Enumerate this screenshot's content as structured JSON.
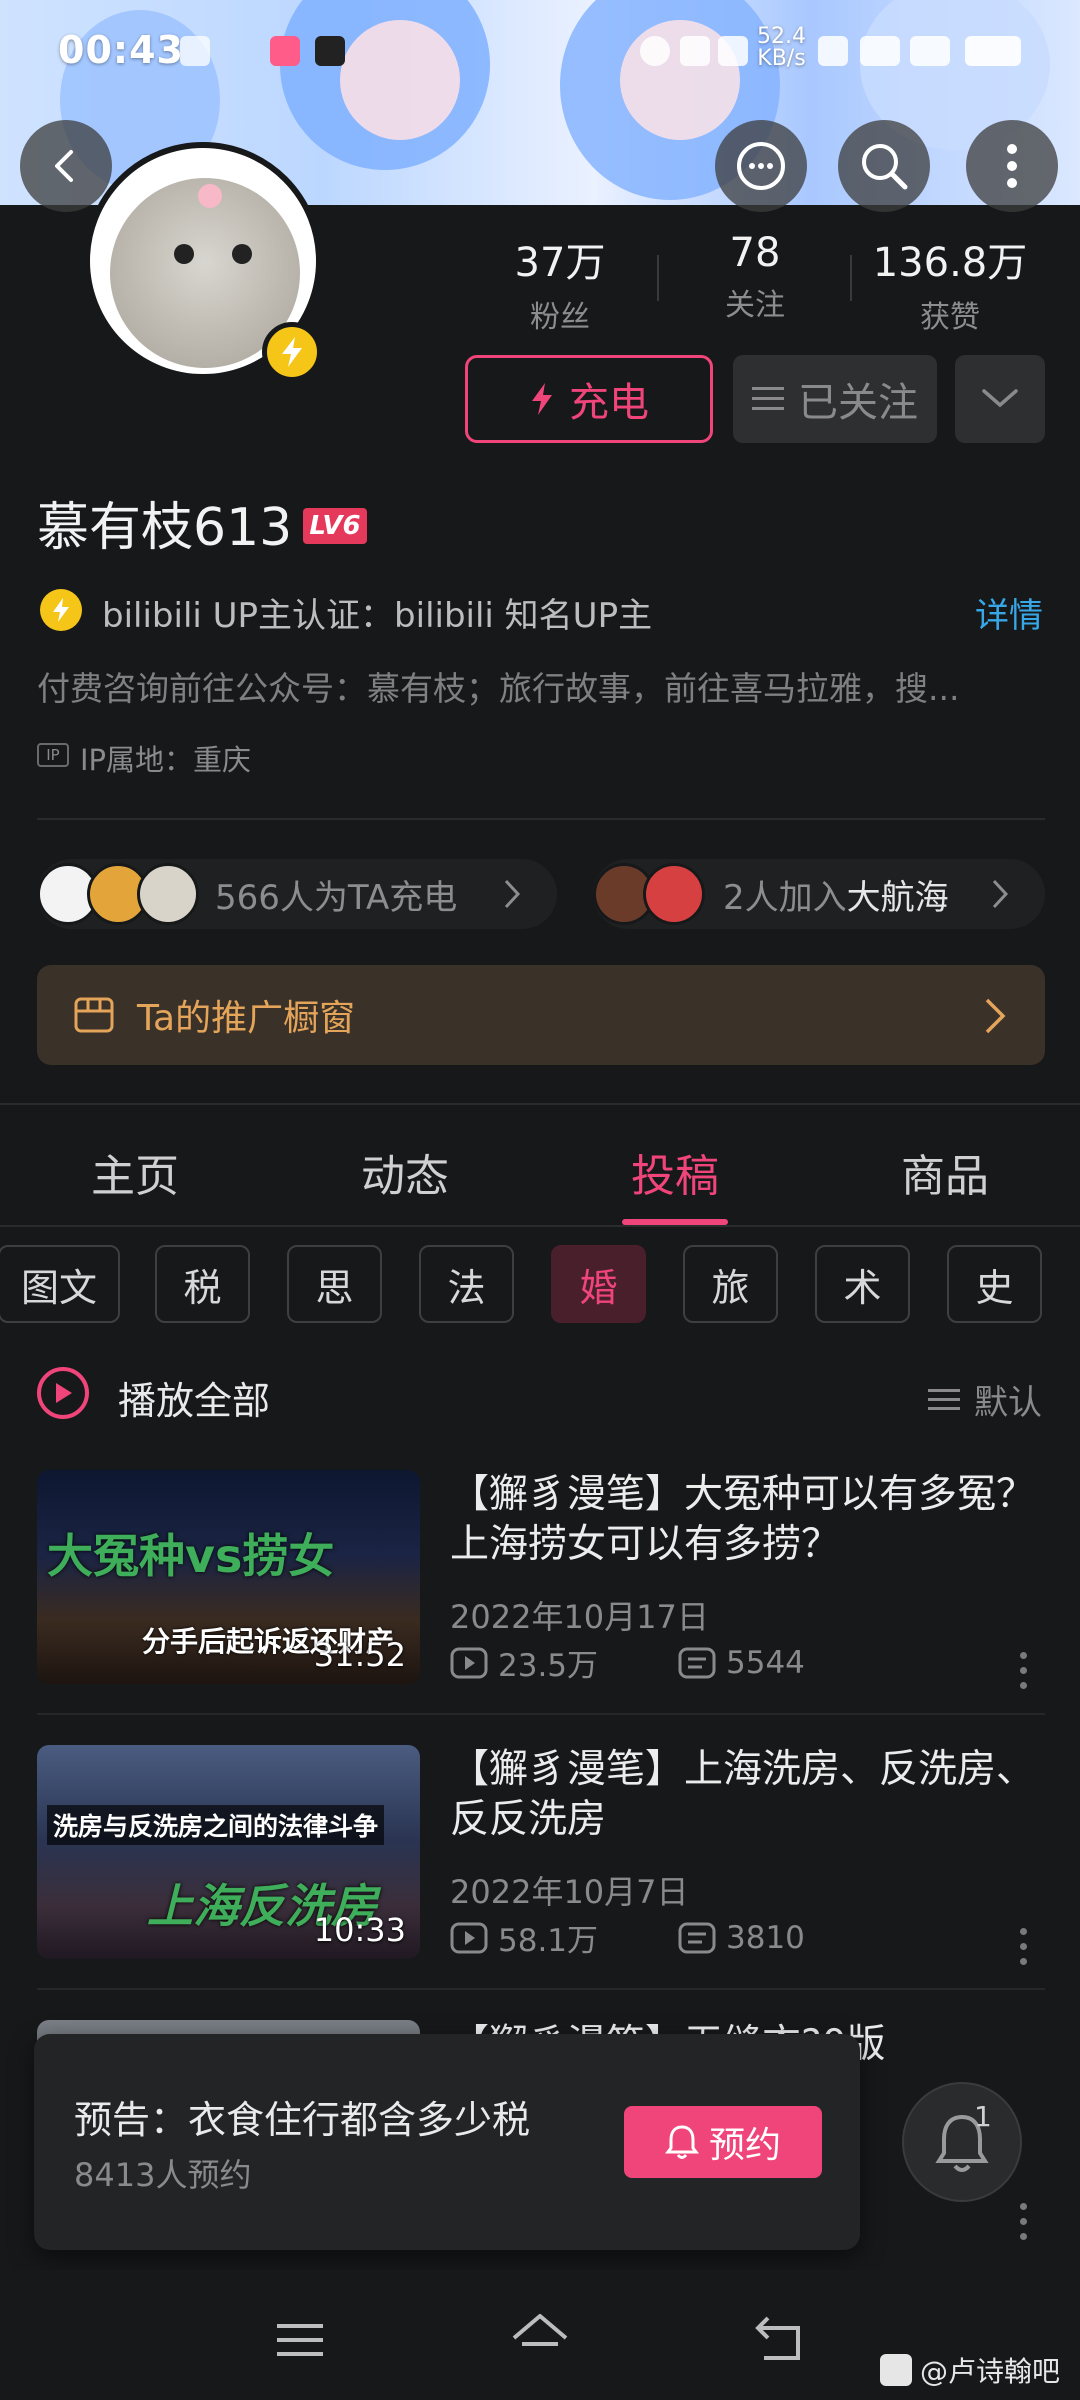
{
  "status_bar": {
    "time": "00:43",
    "net_speed": "52.4",
    "net_unit": "KB/s"
  },
  "profile": {
    "stats": [
      {
        "value": "37万",
        "label": "粉丝"
      },
      {
        "value": "78",
        "label": "关注"
      },
      {
        "value": "136.8万",
        "label": "获赞"
      }
    ],
    "charge_label": "充电",
    "followed_label": "已关注",
    "name": "慕有枝613",
    "level": "LV6",
    "certification": "bilibili UP主认证：bilibili 知名UP主",
    "detail_link": "详情",
    "bio": "付费咨询前往公众号：慕有枝；旅行故事，前往喜马拉雅，搜...",
    "ip_tag": "IP",
    "ip_location": "IP属地：重庆"
  },
  "supporters": {
    "charge_count": "566人为TA充电",
    "fleet_count": "2人加入",
    "fleet_name": "大航海"
  },
  "shop_window": {
    "label": "Ta的推广橱窗"
  },
  "tabs": [
    {
      "label": "主页"
    },
    {
      "label": "动态"
    },
    {
      "label": "投稿"
    },
    {
      "label": "商品"
    }
  ],
  "filter_chips": [
    {
      "label": "图文"
    },
    {
      "label": "税"
    },
    {
      "label": "思"
    },
    {
      "label": "法"
    },
    {
      "label": "婚"
    },
    {
      "label": "旅"
    },
    {
      "label": "术"
    },
    {
      "label": "史"
    }
  ],
  "play_all": "播放全部",
  "sort_label": "默认",
  "videos": [
    {
      "title": "【獬豸漫笔】大冤种可以有多冤？上海捞女可以有多捞？",
      "date": "2022年10月17日",
      "views": "23.5万",
      "comments": "5544",
      "duration": "31:52",
      "thumb_caption_main": "大冤种vs捞女",
      "thumb_caption_sub": "分手后起诉返还财产"
    },
    {
      "title": "【獬豸漫笔】上海洗房、反洗房、反反洗房",
      "date": "2022年10月7日",
      "views": "58.1万",
      "comments": "3810",
      "duration": "10:33",
      "thumb_caption_main": "上海反洗房",
      "thumb_caption_sub": "洗房与反洗房之间的法律斗争"
    },
    {
      "title_fragment": "【獬豸漫笔】无缝衣?0版"
    }
  ],
  "notice": {
    "title": "预告：衣食住行都含多少税",
    "count": "8413人预约",
    "reserve_label": "预约",
    "bell_badge": "1"
  },
  "watermark": "@卢诗翰吧",
  "colors": {
    "accent": "#f0457a",
    "link": "#37a7e8",
    "gold": "#f5c518",
    "shop": "#e4a45a"
  }
}
